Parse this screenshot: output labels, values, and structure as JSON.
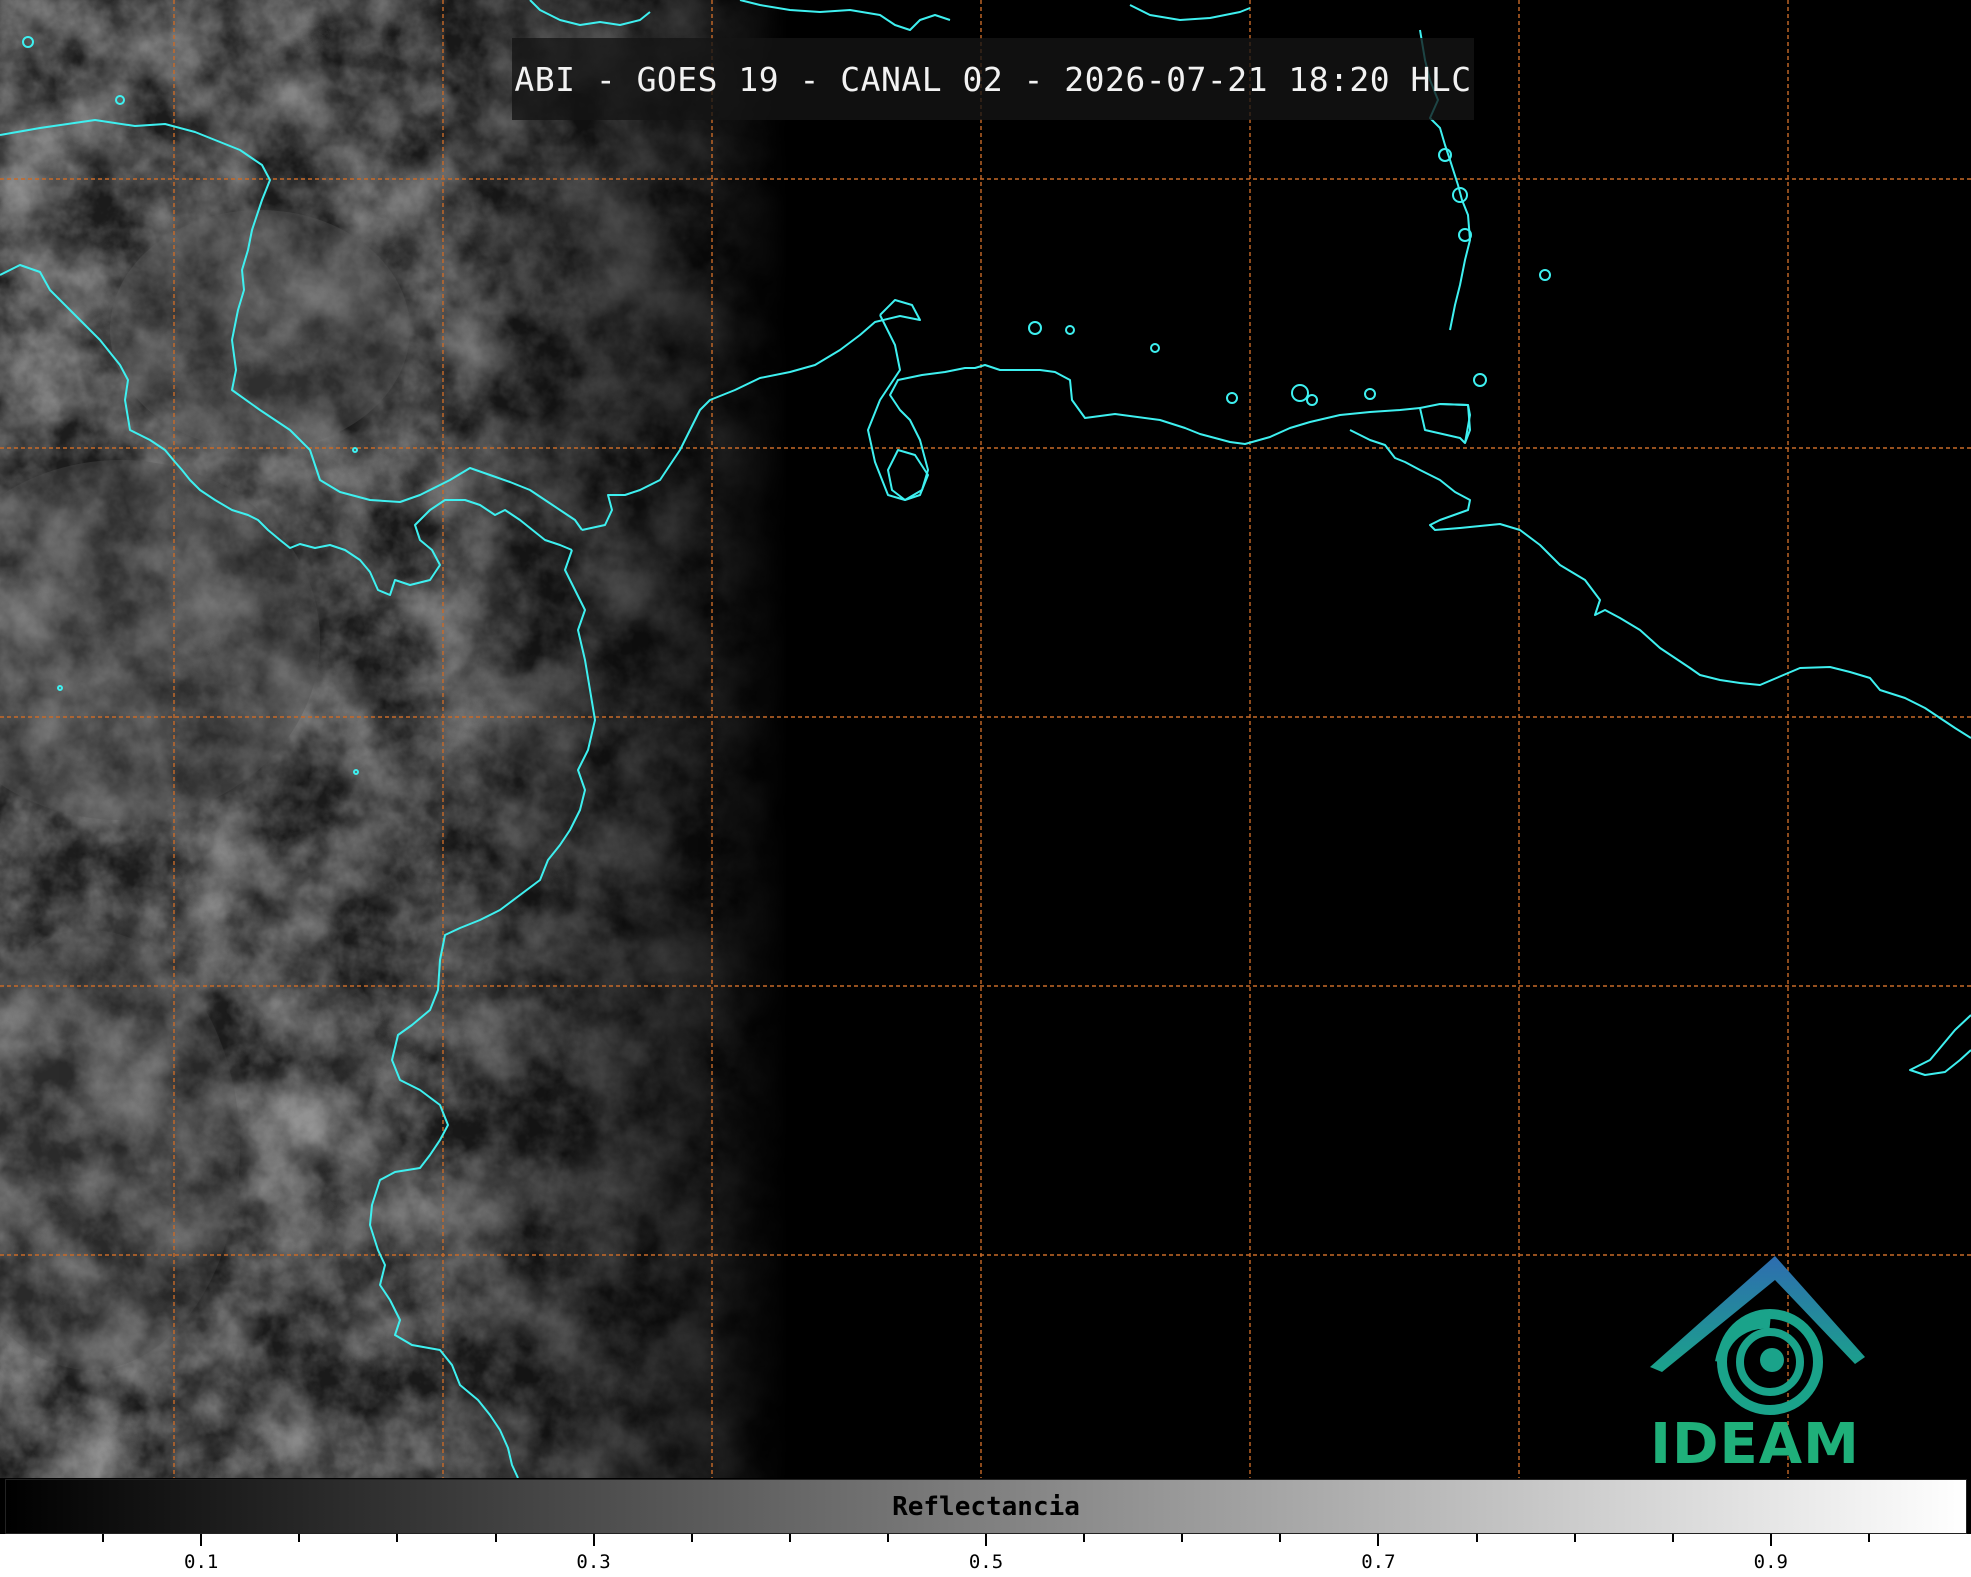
{
  "title": "ABI - GOES 19 - CANAL 02 - 2026-07-21 18:20 HLC",
  "logo": {
    "name": "IDEAM",
    "text": "IDEAM",
    "icon": "ideam-logo-icon"
  },
  "colorbar": {
    "label": "Reflectancia",
    "range": [
      0.0,
      1.0
    ],
    "gradient": [
      "#000000",
      "#ffffff"
    ],
    "major_ticks": [
      0.1,
      0.3,
      0.5,
      0.7,
      0.9
    ],
    "tick_labels": [
      "0.1",
      "0.3",
      "0.5",
      "0.7",
      "0.9"
    ],
    "minor_ticks": [
      0.05,
      0.15,
      0.2,
      0.25,
      0.35,
      0.4,
      0.45,
      0.55,
      0.6,
      0.65,
      0.75,
      0.8,
      0.85,
      0.95
    ]
  },
  "colors": {
    "coastline": "#3ef0f0",
    "gridlines": "#c86a28",
    "logo_teal": "#1aa38a",
    "logo_blue": "#2e6db0",
    "logo_text": "#1fb07a"
  }
}
